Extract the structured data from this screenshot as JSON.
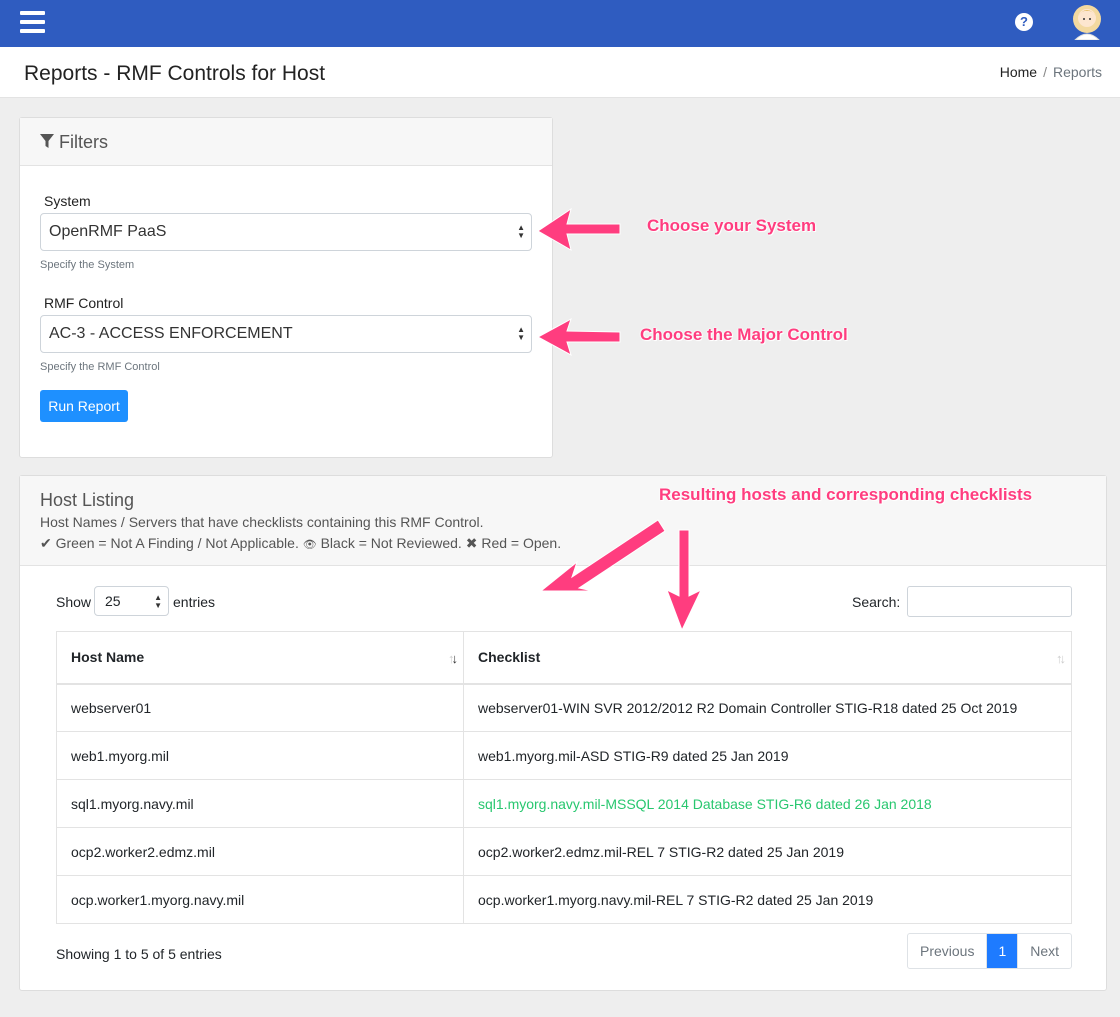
{
  "topbar": {
    "menu_icon": "hamburger-icon",
    "help_icon": "question-circle-icon",
    "help_glyph": "?",
    "avatar_icon": "user-avatar-icon",
    "color": "#2f5cc0"
  },
  "page": {
    "title": "Reports - RMF Controls for Host"
  },
  "breadcrumb": {
    "home": "Home",
    "separator": "/",
    "current": "Reports"
  },
  "filters": {
    "title": "Filters",
    "system": {
      "label": "System",
      "value": "OpenRMF PaaS",
      "help": "Specify the System"
    },
    "control": {
      "label": "RMF Control",
      "value": "AC-3 - ACCESS ENFORCEMENT",
      "help": "Specify the RMF Control"
    },
    "run_button": "Run Report"
  },
  "annotations": {
    "system": "Choose your System",
    "control": "Choose the Major Control",
    "results": "Resulting hosts and corresponding checklists",
    "color": "#ff3d7f"
  },
  "host_listing": {
    "title": "Host Listing",
    "subtitle": "Host Names / Servers that have checklists containing this RMF Control.",
    "legend": [
      {
        "icon": "check-icon",
        "glyph": "✔",
        "text": "Green = Not A Finding / Not Applicable."
      },
      {
        "icon": "eye-slash-icon",
        "glyph": "👁",
        "text": "Black = Not Reviewed."
      },
      {
        "icon": "times-icon",
        "glyph": "✖",
        "text": "Red = Open."
      }
    ],
    "show_label": "Show",
    "entries_value": "25",
    "entries_label": "entries",
    "search_label": "Search:",
    "search_value": "",
    "columns": [
      "Host Name",
      "Checklist"
    ],
    "rows": [
      {
        "host": "webserver01",
        "checklist": "webserver01-WIN SVR 2012/2012 R2 Domain Controller STIG-R18 dated 25 Oct 2019",
        "status": "black"
      },
      {
        "host": "web1.myorg.mil",
        "checklist": "web1.myorg.mil-ASD STIG-R9 dated 25 Jan 2019",
        "status": "black"
      },
      {
        "host": "sql1.myorg.navy.mil",
        "checklist": "sql1.myorg.navy.mil-MSSQL 2014 Database STIG-R6 dated 26 Jan 2018",
        "status": "green"
      },
      {
        "host": "ocp2.worker2.edmz.mil",
        "checklist": "ocp2.worker2.edmz.mil-REL 7 STIG-R2 dated 25 Jan 2019",
        "status": "black"
      },
      {
        "host": "ocp.worker1.myorg.navy.mil",
        "checklist": "ocp.worker1.myorg.navy.mil-REL 7 STIG-R2 dated 25 Jan 2019",
        "status": "black"
      }
    ],
    "showing": "Showing 1 to 5 of 5 entries",
    "pagination": {
      "previous": "Previous",
      "current": "1",
      "next": "Next"
    }
  }
}
